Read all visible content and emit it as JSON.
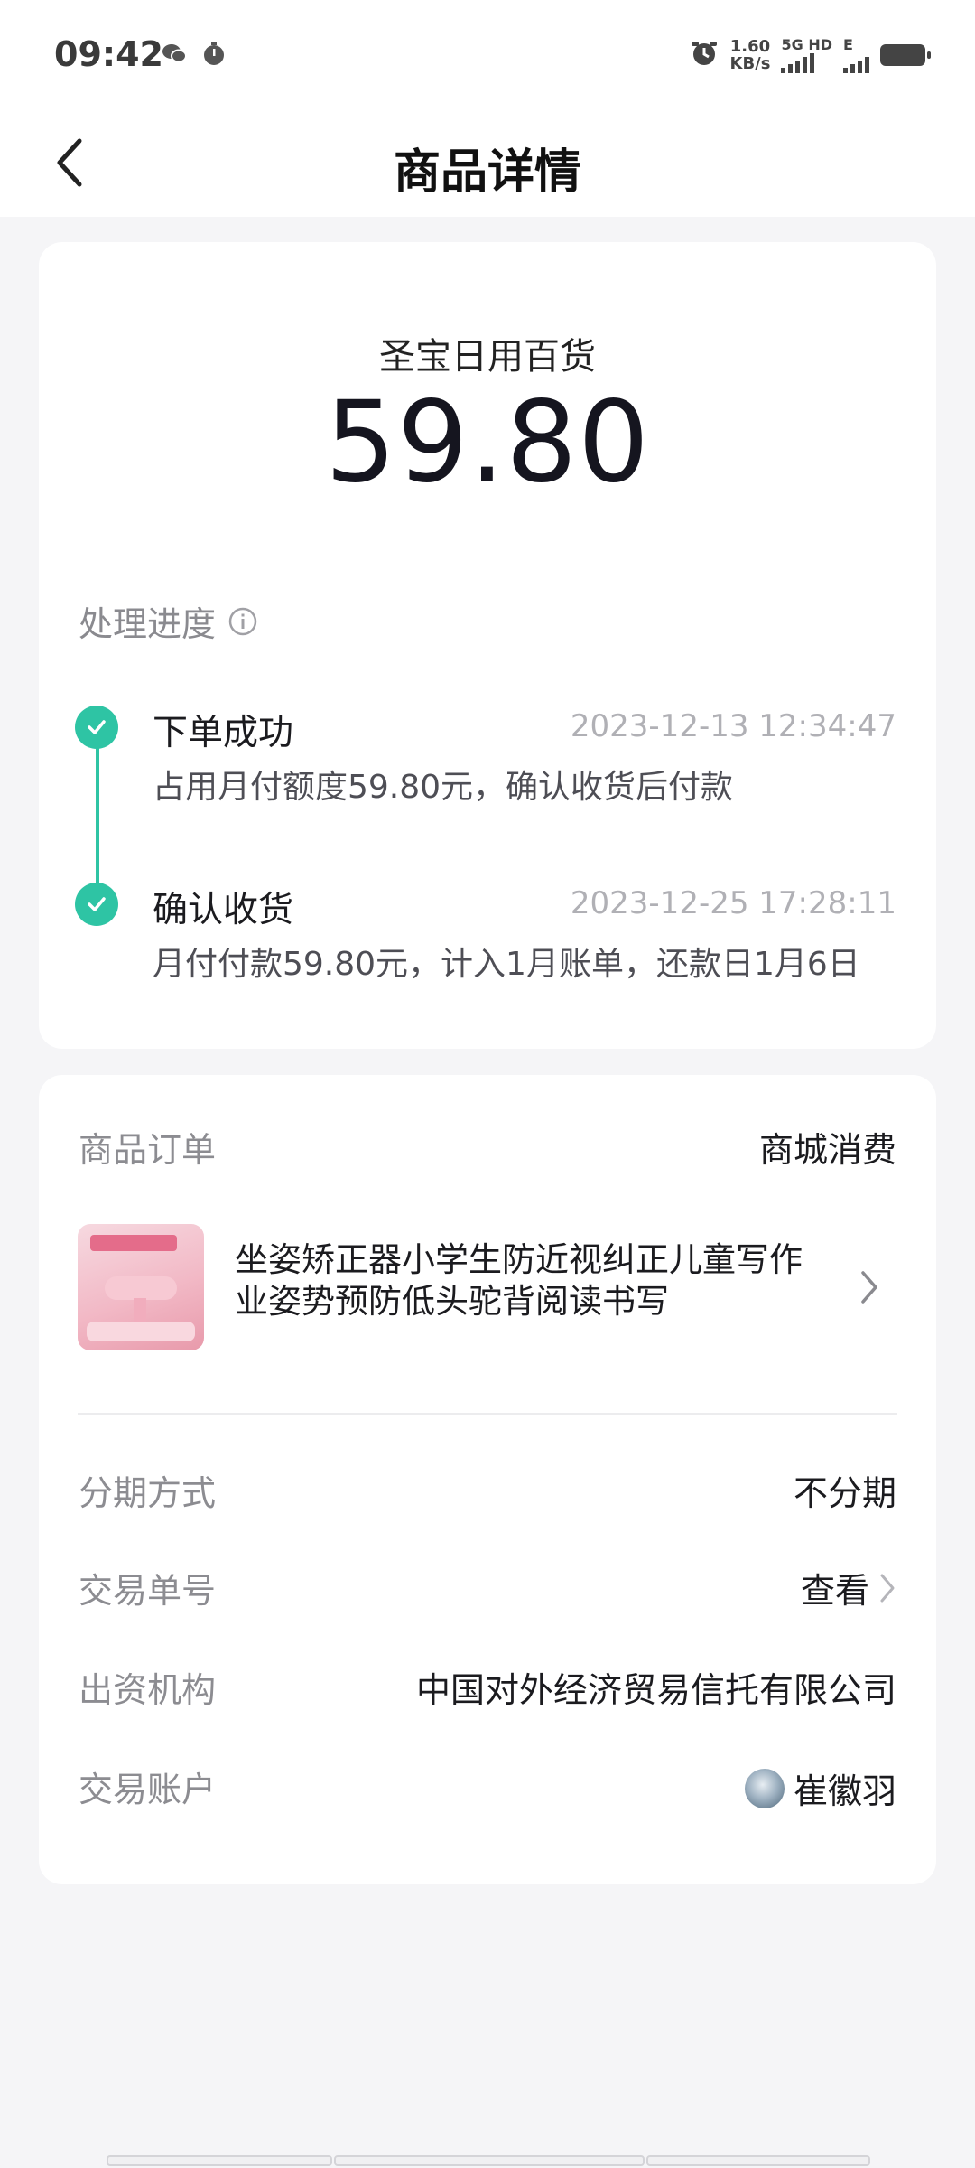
{
  "status_bar": {
    "time": "09:42",
    "icons_left": [
      "wechat-icon",
      "timer-icon"
    ],
    "alarm_icon": "alarm-icon",
    "net_speed_value": "1.60",
    "net_speed_unit": "KB/s",
    "net_tech_1": "5G HD",
    "net_tech_2": "E"
  },
  "header": {
    "back_icon": "chevron-left-icon",
    "title": "商品详情"
  },
  "summary": {
    "merchant": "圣宝日用百货",
    "amount": "59.80",
    "progress_title": "处理进度",
    "accent_color": "#2ec4a4",
    "steps": [
      {
        "title": "下单成功",
        "time": "2023-12-13 12:34:47",
        "desc": "占用月付额度59.80元，确认收货后付款"
      },
      {
        "title": "确认收货",
        "time": "2023-12-25 17:28:11",
        "desc": "月付付款59.80元，计入1月账单，还款日1月6日"
      }
    ]
  },
  "order": {
    "label": "商品订单",
    "value": "商城消费",
    "product_name_line1": "坐姿矫正器小学生防近视纠正儿童写作",
    "product_name_line2": "业姿势预防低头驼背阅读书写",
    "rows": [
      {
        "label": "分期方式",
        "value": "不分期"
      },
      {
        "label": "交易单号",
        "value": "查看"
      },
      {
        "label": "出资机构",
        "value": "中国对外经济贸易信托有限公司"
      },
      {
        "label": "交易账户",
        "value": "崔徽羽"
      }
    ]
  }
}
